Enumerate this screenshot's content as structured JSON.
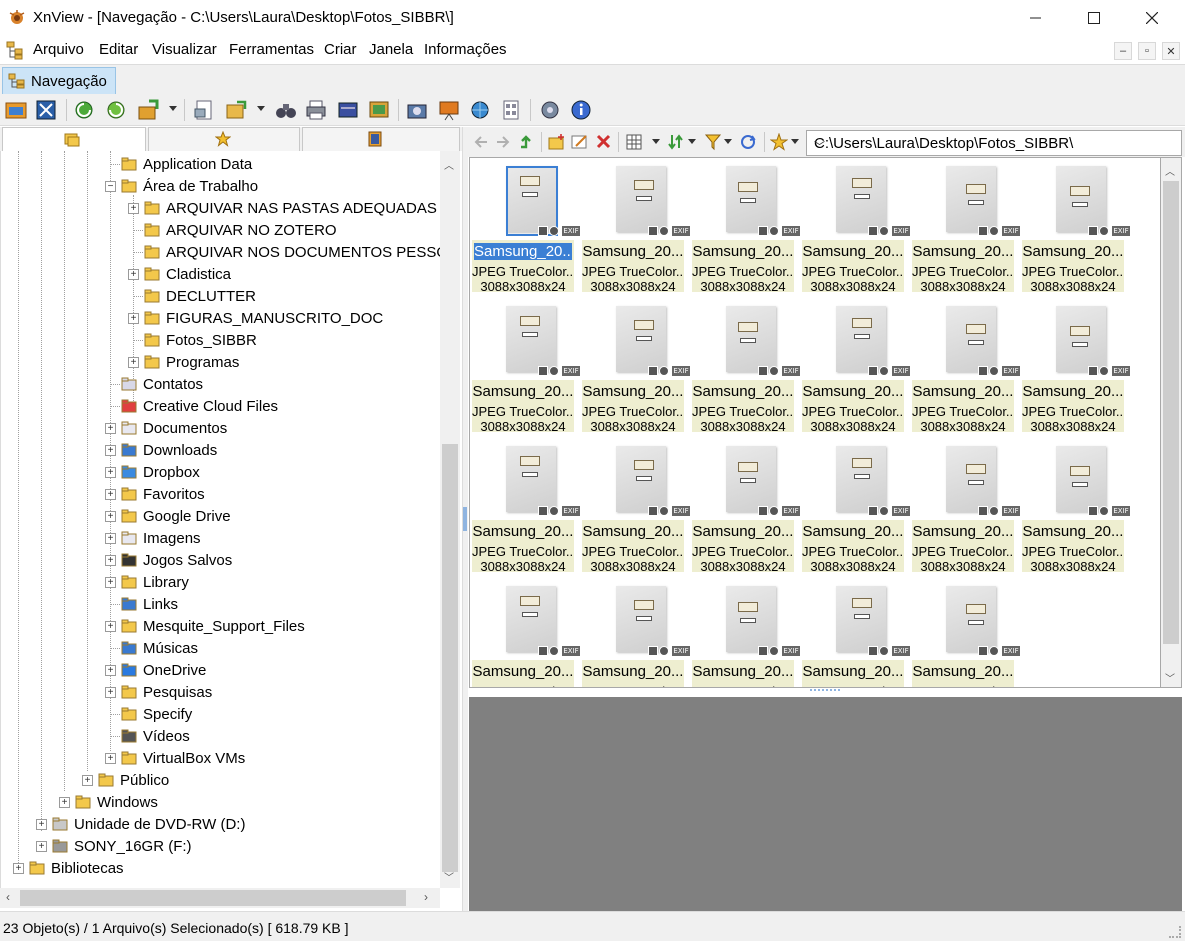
{
  "window": {
    "title": "XnView - [Navegação - C:\\Users\\Laura\\Desktop\\Fotos_SIBBR\\]"
  },
  "menu": [
    "Arquivo",
    "Editar",
    "Visualizar",
    "Ferramentas",
    "Criar",
    "Janela",
    "Informações"
  ],
  "tab": {
    "label": "Navegação"
  },
  "path": {
    "value": "C:\\Users\\Laura\\Desktop\\Fotos_SIBBR\\"
  },
  "tree": [
    {
      "label": "Application Data",
      "level": 5,
      "expander": "none",
      "icon": "folder"
    },
    {
      "label": "Área de Trabalho",
      "level": 5,
      "expander": "minus",
      "icon": "folder-blue"
    },
    {
      "label": "ARQUIVAR NAS PASTAS ADEQUADAS",
      "level": 6,
      "expander": "plus",
      "icon": "folder"
    },
    {
      "label": "ARQUIVAR NO ZOTERO",
      "level": 6,
      "expander": "none",
      "icon": "folder"
    },
    {
      "label": "ARQUIVAR NOS DOCUMENTOS PESSOAI",
      "level": 6,
      "expander": "none",
      "icon": "folder"
    },
    {
      "label": "Cladistica",
      "level": 6,
      "expander": "plus",
      "icon": "folder"
    },
    {
      "label": "DECLUTTER",
      "level": 6,
      "expander": "none",
      "icon": "folder"
    },
    {
      "label": "FIGURAS_MANUSCRITO_DOC",
      "level": 6,
      "expander": "plus",
      "icon": "folder"
    },
    {
      "label": "Fotos_SIBBR",
      "level": 6,
      "expander": "none",
      "icon": "folder"
    },
    {
      "label": "Programas",
      "level": 6,
      "expander": "plus",
      "icon": "folder"
    },
    {
      "label": "Contatos",
      "level": 5,
      "expander": "none",
      "icon": "contacts"
    },
    {
      "label": "Creative Cloud Files",
      "level": 5,
      "expander": "none",
      "icon": "creative-cloud"
    },
    {
      "label": "Documentos",
      "level": 5,
      "expander": "plus",
      "icon": "documents"
    },
    {
      "label": "Downloads",
      "level": 5,
      "expander": "plus",
      "icon": "downloads"
    },
    {
      "label": "Dropbox",
      "level": 5,
      "expander": "plus",
      "icon": "dropbox"
    },
    {
      "label": "Favoritos",
      "level": 5,
      "expander": "plus",
      "icon": "favorites"
    },
    {
      "label": "Google Drive",
      "level": 5,
      "expander": "plus",
      "icon": "folder"
    },
    {
      "label": "Imagens",
      "level": 5,
      "expander": "plus",
      "icon": "images"
    },
    {
      "label": "Jogos Salvos",
      "level": 5,
      "expander": "plus",
      "icon": "games"
    },
    {
      "label": "Library",
      "level": 5,
      "expander": "plus",
      "icon": "folder"
    },
    {
      "label": "Links",
      "level": 5,
      "expander": "none",
      "icon": "links"
    },
    {
      "label": "Mesquite_Support_Files",
      "level": 5,
      "expander": "plus",
      "icon": "folder"
    },
    {
      "label": "Músicas",
      "level": 5,
      "expander": "none",
      "icon": "music"
    },
    {
      "label": "OneDrive",
      "level": 5,
      "expander": "plus",
      "icon": "onedrive"
    },
    {
      "label": "Pesquisas",
      "level": 5,
      "expander": "plus",
      "icon": "search"
    },
    {
      "label": "Specify",
      "level": 5,
      "expander": "none",
      "icon": "folder"
    },
    {
      "label": "Vídeos",
      "level": 5,
      "expander": "none",
      "icon": "videos"
    },
    {
      "label": "VirtualBox VMs",
      "level": 5,
      "expander": "plus",
      "icon": "folder"
    },
    {
      "label": "Público",
      "level": 4,
      "expander": "plus",
      "icon": "folder"
    },
    {
      "label": "Windows",
      "level": 3,
      "expander": "plus",
      "icon": "folder"
    },
    {
      "label": "Unidade de DVD-RW (D:)",
      "level": 2,
      "expander": "plus",
      "icon": "dvd"
    },
    {
      "label": "SONY_16GR (F:)",
      "level": 2,
      "expander": "plus",
      "icon": "usb-drive"
    },
    {
      "label": "Bibliotecas",
      "level": 1,
      "expander": "plus",
      "icon": "libraries"
    }
  ],
  "thumbnails": {
    "count": 23,
    "name": "Samsung_20...",
    "type": "JPEG TrueColor...",
    "dims": "3088x3088x24",
    "selected_index": 0
  },
  "status": {
    "text": "23 Objeto(s) / 1 Arquivo(s) Selecionado(s)   [ 618.79 KB ]"
  },
  "colors": {
    "selection": "#3b7fd4",
    "thumb_info_bg": "#eeeed0",
    "preview_bg": "#808080",
    "folder": "#f3c84b"
  }
}
